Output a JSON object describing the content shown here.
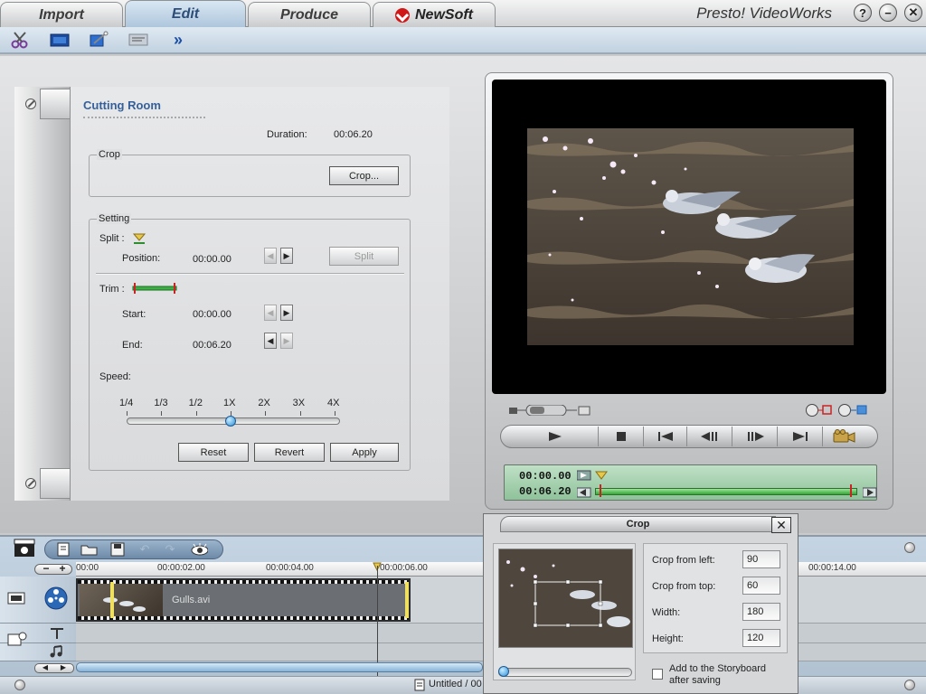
{
  "tabs": [
    {
      "label": "Import"
    },
    {
      "label": "Edit"
    },
    {
      "label": "Produce"
    },
    {
      "label": "NewSoft"
    }
  ],
  "app_title": "Presto! VideoWorks",
  "window_buttons": {
    "help": "?",
    "minimize": "−",
    "close": "✕"
  },
  "toolbar": {
    "more": "»"
  },
  "cutting_room": {
    "title": "Cutting Room",
    "duration_label": "Duration:",
    "duration_value": "00:06.20",
    "crop_group": "Crop",
    "crop_button": "Crop...",
    "setting_group": "Setting",
    "split_label": "Split :",
    "position_label": "Position:",
    "position_value": "00:00.00",
    "split_button": "Split",
    "trim_label": "Trim :",
    "start_label": "Start:",
    "start_value": "00:00.00",
    "end_label": "End:",
    "end_value": "00:06.20",
    "speed_label": "Speed:",
    "speed_ticks": [
      "1/4",
      "1/3",
      "1/2",
      "1X",
      "2X",
      "3X",
      "4X"
    ],
    "speed_value": "1X",
    "reset_button": "Reset",
    "revert_button": "Revert",
    "apply_button": "Apply"
  },
  "player": {
    "current_time": "00:00.00",
    "total_time": "00:06.20"
  },
  "timeline": {
    "ruler_labels": [
      "00:00",
      "00:00:02.00",
      "00:00:04.00",
      "00:00:06.00",
      "00:00:14.00"
    ],
    "clip_name": "Gulls.avi",
    "status": "Untitled / 00"
  },
  "crop_dialog": {
    "title": "Crop",
    "close": "✕",
    "crop_left_label": "Crop from left:",
    "crop_left_value": "90",
    "crop_top_label": "Crop from top:",
    "crop_top_value": "60",
    "width_label": "Width:",
    "width_value": "180",
    "height_label": "Height:",
    "height_value": "120",
    "add_label_1": "Add to the Storyboard",
    "add_label_2": "after saving"
  }
}
